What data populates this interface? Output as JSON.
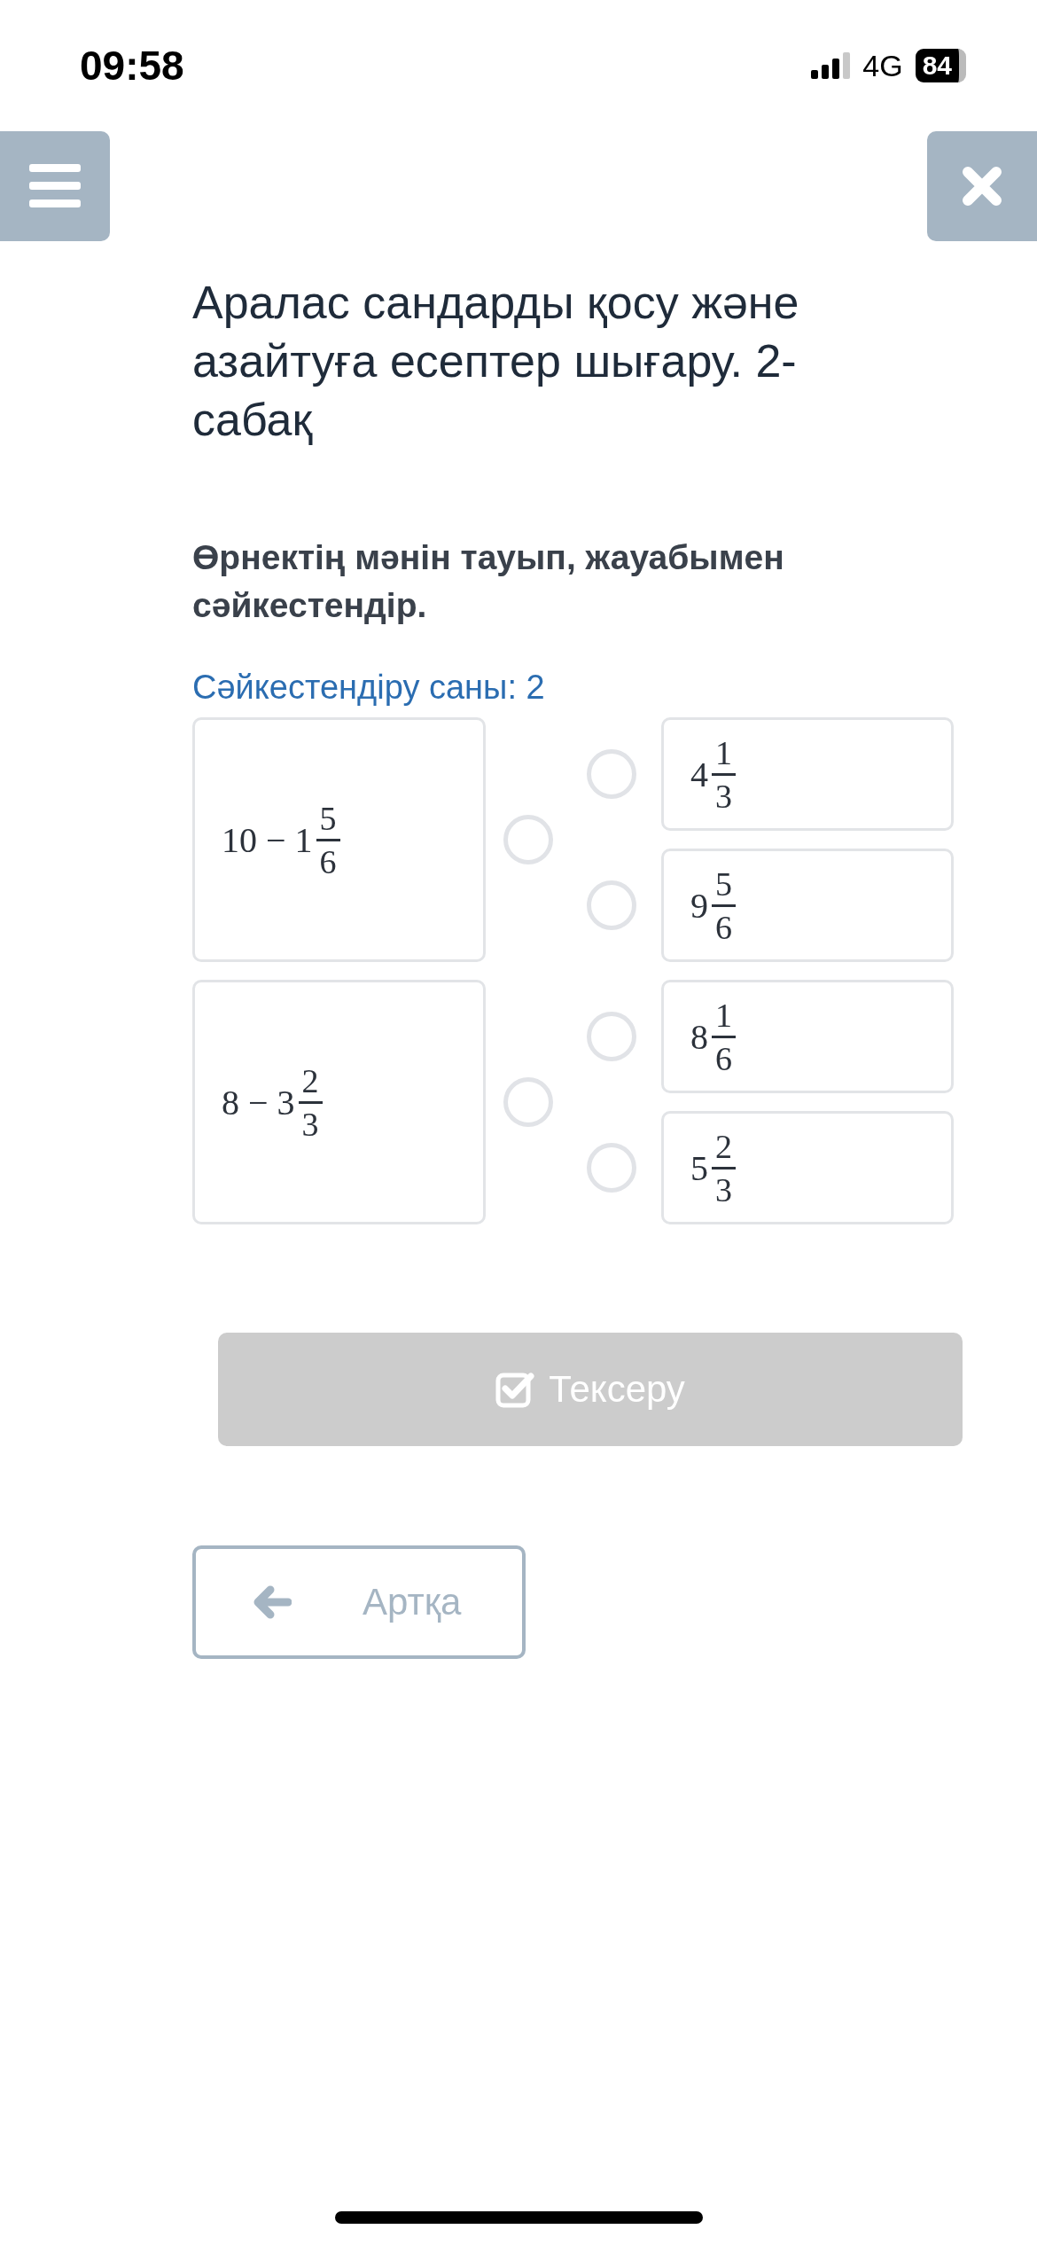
{
  "status_bar": {
    "time": "09:58",
    "network": "4G",
    "battery": "84"
  },
  "title": "Аралас сандарды қосу және азайтуға есептер шығару. 2-сабақ",
  "instruction": "Өрнектің мәнін тауып, жауабымен сәйкестендір.",
  "match_count": "Сәйкестендіру саны: 2",
  "expressions": [
    {
      "whole": "10 − 1",
      "numerator": "5",
      "denominator": "6",
      "selected": false
    },
    {
      "whole": "8 − 3",
      "numerator": "2",
      "denominator": "3",
      "selected": false
    }
  ],
  "answers": [
    {
      "whole": "4",
      "numerator": "1",
      "denominator": "3",
      "selected": false
    },
    {
      "whole": "9",
      "numerator": "5",
      "denominator": "6",
      "selected": false
    },
    {
      "whole": "8",
      "numerator": "1",
      "denominator": "6",
      "selected": false
    },
    {
      "whole": "5",
      "numerator": "2",
      "denominator": "3",
      "selected": false
    }
  ],
  "check_button": {
    "label": "Тексеру",
    "disabled": true
  },
  "back_button": {
    "label": "Артқа"
  }
}
